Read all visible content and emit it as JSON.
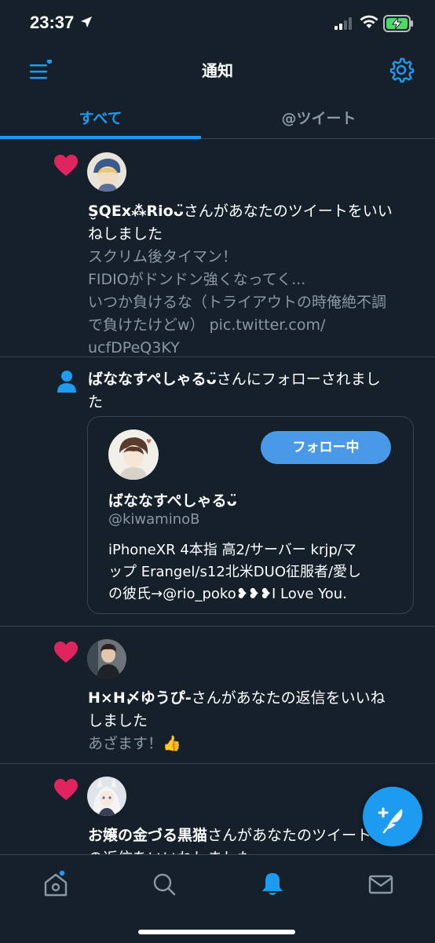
{
  "status_bar": {
    "time": "23:37"
  },
  "header": {
    "title": "通知"
  },
  "tabs": [
    {
      "label": "すべて",
      "active": true
    },
    {
      "label": "@ツイート",
      "active": false
    }
  ],
  "notifications": [
    {
      "type": "like",
      "user": "S̮QEx⁂Rioᴗ̈",
      "action_line1": "さんがあなたのツイートをいい",
      "action_line2": "ねしました",
      "tweet_lines": [
        "スクリム後タイマン！",
        "FIDIOがドンドン強くなってく...",
        "いつか負けるな（トライアウトの時俺絶不調",
        "で負けたけどw） pic.twitter.com/",
        "ucfDPeQ3KY"
      ]
    },
    {
      "type": "follow",
      "user": "ばななすぺしゃるᴗ̈",
      "action_line1": "さんにフォローされまし",
      "action_line2": "た",
      "card": {
        "follow_button": "フォロー中",
        "display_name": "ばななすぺしゃるᴗ̈",
        "handle": "@kiwaminoB",
        "bio_lines": [
          "iPhoneXR 4本指 高2/サーバー krjp/マ",
          "ップ Erangel/s12北米DUO征服者/愛し",
          "の彼氏→@rio_poko❥❥❥I Love You."
        ]
      }
    },
    {
      "type": "like",
      "user": "H×H〆ゆうぴ-",
      "action_line1": "さんがあなたの返信をいいね",
      "action_line2": "しました",
      "tweet_lines": [
        "あざます！👍"
      ]
    },
    {
      "type": "like",
      "user": "お嬢の金づる黒猫",
      "action_line1": "さんがあなたのツイート",
      "action_line2": "の返信をいいねしました"
    }
  ],
  "colors": {
    "background": "#15202b",
    "accent": "#1d9bf0",
    "like": "#e0245e",
    "divider": "#38444d",
    "secondary_text": "#8899a6"
  },
  "icons": {
    "menu": "menu-icon",
    "settings": "gear-icon",
    "like": "heart-icon",
    "follow": "person-icon",
    "compose": "compose-icon",
    "home": "home-icon",
    "search": "search-icon",
    "notifications": "bell-icon",
    "messages": "mail-icon"
  }
}
